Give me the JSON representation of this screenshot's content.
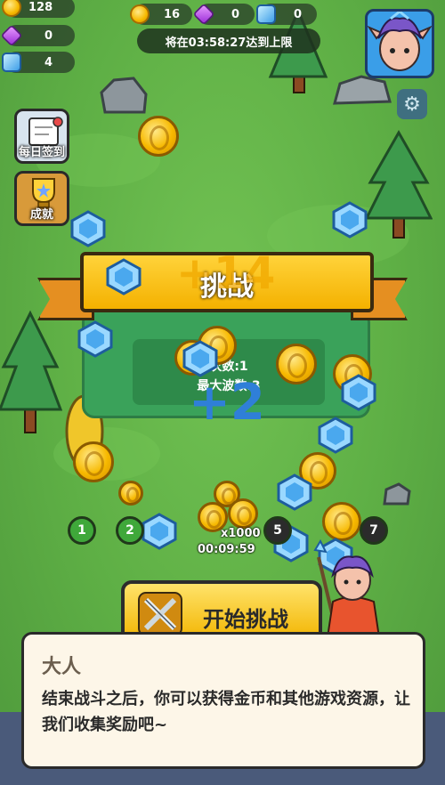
{
  "left_resources": {
    "coins": "128",
    "gems": "0",
    "crystals": "4"
  },
  "top_resources": {
    "coins": "16",
    "gems": "0",
    "crystals": "0"
  },
  "timer_text": "将在03:58:27达到上限",
  "side_buttons": {
    "daily_signin": "每日签到",
    "achievements": "成就"
  },
  "result_panel": {
    "banner_text": "挑战",
    "line1": "次数:1",
    "line2": "最大波数:3"
  },
  "floating_rewards": {
    "coin_gain": "+14",
    "crystal_gain": "+2"
  },
  "waves": {
    "items": [
      "1",
      "2",
      "3",
      "4",
      "5",
      "6",
      "7"
    ],
    "multiplier": "x1000",
    "countdown": "00:09:59"
  },
  "start_button_label": "开始挑战",
  "dialog": {
    "speaker": "大人",
    "text": "结束战斗之后，你可以获得金币和其他游戏资源，让我们收集奖励吧~"
  },
  "colors": {
    "grass": "#5fae49",
    "ribbon": "#f4b100",
    "panel": "#3aa25a",
    "plus_coin": "#f0a800",
    "plus_crystal": "#2f7fd8"
  }
}
